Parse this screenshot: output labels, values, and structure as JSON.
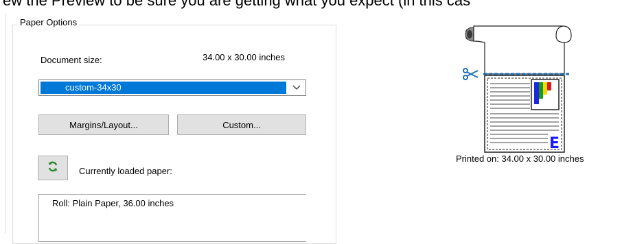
{
  "document_text": "ew the Preview to be sure you are getting what you expect (in this cas",
  "paper_options": {
    "group_title": "Paper Options",
    "document_size_label": "Document size:",
    "document_size_value": "34.00 x 30.00 inches",
    "selected_size": "custom-34x30",
    "margins_button": "Margins/Layout...",
    "custom_button": "Custom...",
    "loaded_paper_label": "Currently loaded paper:",
    "loaded_paper_value": "Roll: Plain Paper, 36.00 inches"
  },
  "preview": {
    "printed_on": "Printed on: 34.00 x 30.00 inches",
    "logo_letter": "E"
  },
  "icons": {
    "refresh": "refresh-icon",
    "dropdown": "chevron-down-icon",
    "scissors": "scissors-icon"
  },
  "colors": {
    "selection": "#0078d7",
    "cut_line": "#1e6fb8",
    "refresh_green": "#2a8a2a",
    "logo_blue": "#1a1aff"
  }
}
